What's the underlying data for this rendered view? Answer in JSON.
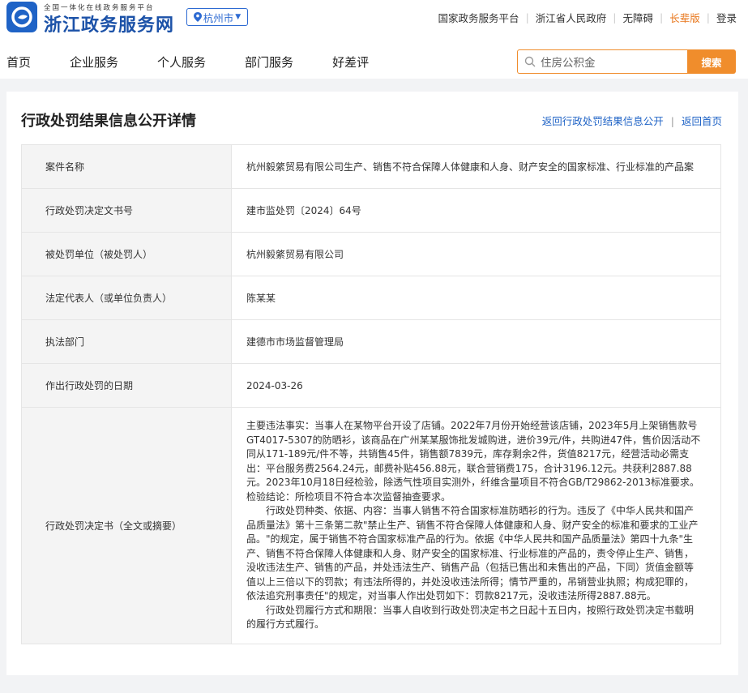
{
  "header": {
    "logo_sub": "全国一体化在线政务服务平台",
    "logo_title": "浙江政务服务网",
    "city": "杭州市",
    "links": [
      "国家政务服务平台",
      "浙江省人民政府",
      "无障碍",
      "长辈版",
      "登录"
    ]
  },
  "nav": [
    "首页",
    "企业服务",
    "个人服务",
    "部门服务",
    "好差评"
  ],
  "search": {
    "placeholder": "住房公积金",
    "button": "搜索"
  },
  "page": {
    "title": "行政处罚结果信息公开详情",
    "link_back": "返回行政处罚结果信息公开",
    "link_home": "返回首页"
  },
  "rows": [
    {
      "label": "案件名称",
      "value": "杭州毅綮贸易有限公司生产、销售不符合保障人体健康和人身、财产安全的国家标准、行业标准的产品案"
    },
    {
      "label": "行政处罚决定文书号",
      "value": "建市监处罚〔2024〕64号"
    },
    {
      "label": "被处罚单位（被处罚人）",
      "value": "杭州毅綮贸易有限公司"
    },
    {
      "label": "法定代表人（或单位负责人）",
      "value": "陈某某"
    },
    {
      "label": "执法部门",
      "value": "建德市市场监督管理局"
    },
    {
      "label": "作出行政处罚的日期",
      "value": "2024-03-26"
    }
  ],
  "decision": {
    "label": "行政处罚决定书（全文或摘要）",
    "p1": "主要违法事实：当事人在某物平台开设了店铺。2022年7月份开始经营该店铺，2023年5月上架销售款号GT4017-5307的防晒衫，该商品在广州某某服饰批发城购进，进价39元/件，共购进47件，售价因活动不同从171-189元/件不等，共销售45件，销售额7839元，库存剩余2件，货值8217元，经营活动必需支出：平台服务费2564.24元，邮费补贴456.88元，联合营销费175，合计3196.12元。共获利2887.88元。2023年10月18日经检验，除透气性项目实测外，纤维含量项目不符合GB/T29862-2013标准要求。检验结论：所检项目不符合本次监督抽查要求。",
    "p2": "行政处罚种类、依据、内容：当事人销售不符合国家标准防晒衫的行为。违反了《中华人民共和国产品质量法》第十三条第二款\"禁止生产、销售不符合保障人体健康和人身、财产安全的标准和要求的工业产品。\"的规定，属于销售不符合国家标准产品的行为。依据《中华人民共和国产品质量法》第四十九条\"生产、销售不符合保障人体健康和人身、财产安全的国家标准、行业标准的产品的，责令停止生产、销售，没收违法生产、销售的产品，并处违法生产、销售产品（包括已售出和未售出的产品，下同）货值金额等值以上三倍以下的罚款；有违法所得的，并处没收违法所得；情节严重的，吊销营业执照；构成犯罪的，依法追究刑事责任\"的规定，对当事人作出处罚如下：罚款8217元，没收违法所得2887.88元。",
    "p3": "行政处罚履行方式和期限：当事人自收到行政处罚决定书之日起十五日内，按照行政处罚决定书载明的履行方式履行。"
  }
}
